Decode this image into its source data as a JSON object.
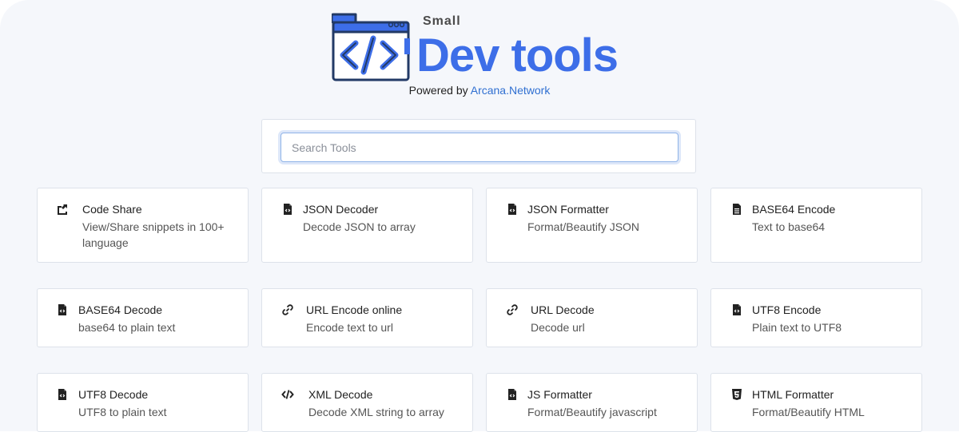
{
  "brand": {
    "small_label": "Small",
    "title": "Dev tools",
    "powered_prefix": "Powered by",
    "powered_link": "Arcana.Network",
    "accent_color": "#3d6ee8"
  },
  "search": {
    "placeholder": "Search Tools",
    "value": ""
  },
  "tools": [
    {
      "title": "Code Share",
      "desc": "View/Share snippets in 100+ language",
      "icon": "share-icon"
    },
    {
      "title": "JSON Decoder",
      "desc": "Decode JSON to array",
      "icon": "code-file-icon"
    },
    {
      "title": "JSON Formatter",
      "desc": "Format/Beautify JSON",
      "icon": "code-file-icon"
    },
    {
      "title": "BASE64 Encode",
      "desc": "Text to base64",
      "icon": "text-file-icon"
    },
    {
      "title": "BASE64 Decode",
      "desc": "base64 to plain text",
      "icon": "code-file-icon"
    },
    {
      "title": "URL Encode online",
      "desc": "Encode text to url",
      "icon": "link-icon"
    },
    {
      "title": "URL Decode",
      "desc": "Decode url",
      "icon": "link-icon"
    },
    {
      "title": "UTF8 Encode",
      "desc": "Plain text to UTF8",
      "icon": "code-file-icon"
    },
    {
      "title": "UTF8 Decode",
      "desc": "UTF8 to plain text",
      "icon": "code-file-icon"
    },
    {
      "title": "XML Decode",
      "desc": "Decode XML string to array",
      "icon": "code-icon"
    },
    {
      "title": "JS Formatter",
      "desc": "Format/Beautify javascript",
      "icon": "code-file-icon"
    },
    {
      "title": "HTML Formatter",
      "desc": "Format/Beautify HTML",
      "icon": "html5-icon"
    }
  ]
}
